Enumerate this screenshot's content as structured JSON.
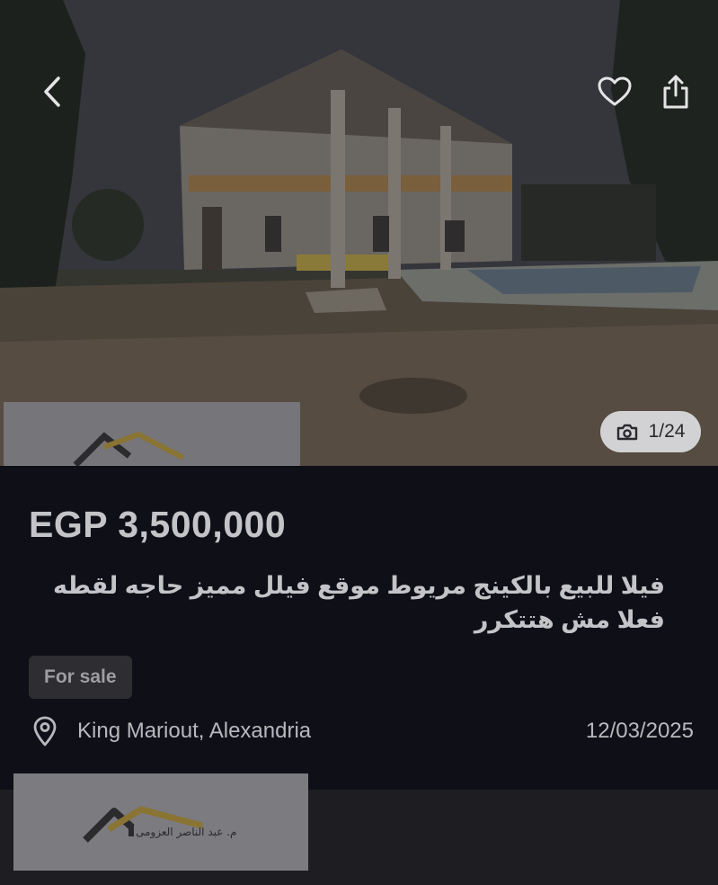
{
  "header": {
    "back_icon": "chevron-left-icon",
    "favorite_icon": "heart-icon",
    "share_icon": "share-icon"
  },
  "gallery": {
    "counter_icon": "camera-icon",
    "counter": "1/24"
  },
  "listing": {
    "price": "EGP 3,500,000",
    "title": "فيلا للبيع بالكينج مريوط موقع فيلل مميز حاجه لقطه فعلا مش هتتكرر",
    "badge": "For sale",
    "location_icon": "location-pin-icon",
    "location": "King Mariout, Alexandria",
    "date": "12/03/2025"
  },
  "watermark": {
    "text": "م. عبد الناصر العزومى"
  },
  "colors": {
    "background": "#0f0f18",
    "text": "#c4c4c8",
    "badge_bg": "#2d2d32",
    "counter_bg": "#d2d2d4"
  }
}
